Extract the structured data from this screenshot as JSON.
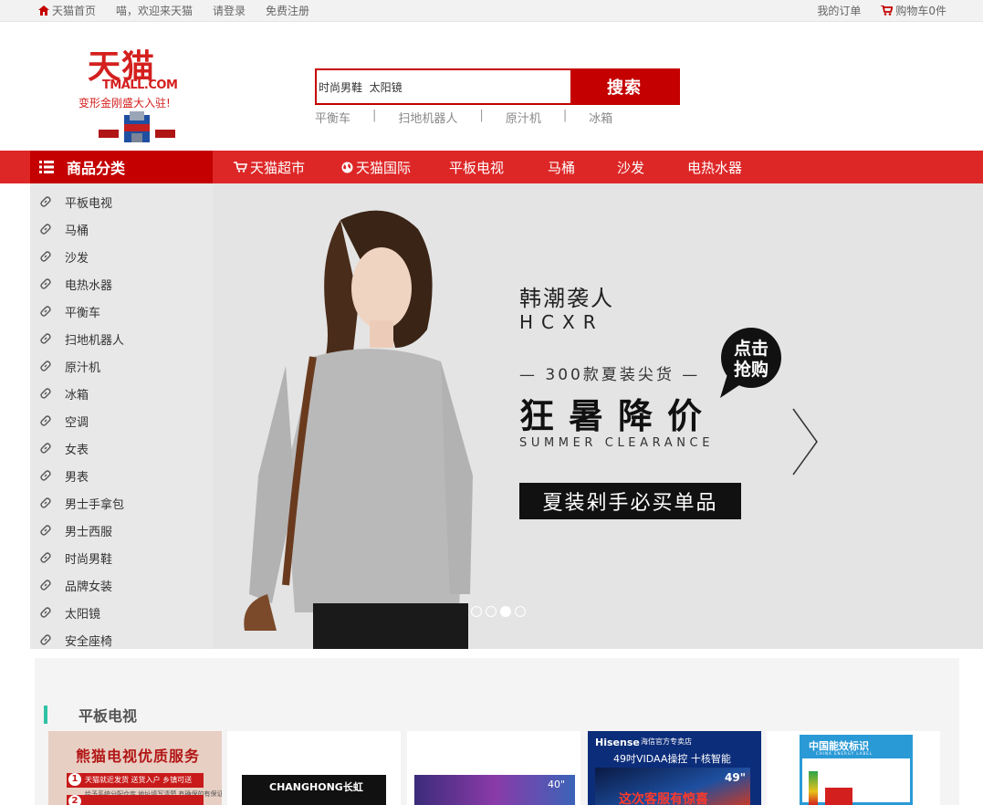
{
  "topbar": {
    "home": "天猫首页",
    "welcome": "喵，欢迎来天猫",
    "login": "请登录",
    "register": "免费注册",
    "orders": "我的订单",
    "cart": "购物车0件"
  },
  "logo": {
    "cn": "天猫",
    "en": "TMALL.COM",
    "slogan": "变形金刚盛大入驻!"
  },
  "search": {
    "value": "时尚男鞋  太阳镜",
    "button": "搜索",
    "hot": [
      "平衡车",
      "扫地机器人",
      "原汁机",
      "冰箱"
    ],
    "separator": "|"
  },
  "nav": {
    "category_title": "商品分类",
    "links": [
      "天猫超市",
      "天猫国际",
      "平板电视",
      "马桶",
      "沙发",
      "电热水器"
    ]
  },
  "sidebar": {
    "items": [
      "平板电视",
      "马桶",
      "沙发",
      "电热水器",
      "平衡车",
      "扫地机器人",
      "原汁机",
      "冰箱",
      "空调",
      "女表",
      "男表",
      "男士手拿包",
      "男士西服",
      "时尚男鞋",
      "品牌女装",
      "太阳镜",
      "安全座椅"
    ]
  },
  "banner": {
    "brand": "韩潮袭人",
    "brand_en": "HCXR",
    "line": "— 300款夏装尖货 —",
    "main": "狂暑降价",
    "en": "SUMMER CLEARANCE",
    "box": "夏装剁手必买单品",
    "bubble_line1": "点击",
    "bubble_line2": "抢购",
    "slides": 4,
    "active_slide": 3
  },
  "floor": {
    "title": "平板电视",
    "p1_title": "熊猫电视优质服务",
    "p1_row": "天猫就近发货 送货入户 乡镇可送",
    "p1_num1": "1",
    "p1_num2": "2",
    "p1_sub": "给予系统分配仓库 地址填写清楚 有确保的有保证",
    "p2_brand": "CHANGHONG长虹",
    "p3_size": "40\"",
    "p4_brand": "Hisense",
    "p4_store": "海信官方专卖店",
    "p4_line": "49吋VIDAA操控 十核智能",
    "p4_size": "49\"",
    "p4_promo": "这次客服有惊喜",
    "p5_title": "中国能效标识",
    "p5_en": "CHINA ENERGY LABEL"
  },
  "colors": {
    "brand_red": "#c40000",
    "nav_red": "#dd2727",
    "accent_teal": "#30c1a4"
  }
}
